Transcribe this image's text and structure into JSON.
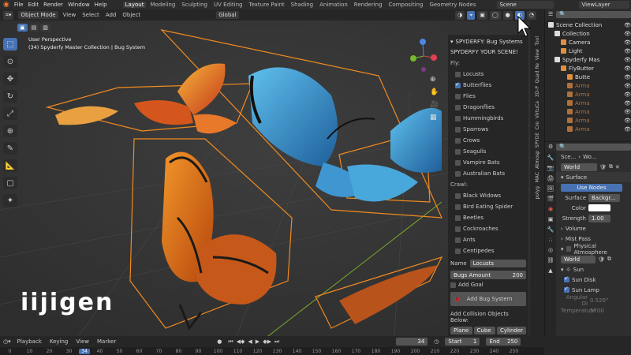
{
  "topbar": {
    "menus": [
      "File",
      "Edit",
      "Render",
      "Window",
      "Help"
    ],
    "tabs": [
      "Layout",
      "Modeling",
      "Sculpting",
      "UV Editing",
      "Texture Paint",
      "Shading",
      "Animation",
      "Rendering",
      "Compositing",
      "Geometry Nodes"
    ],
    "active_tab": "Layout",
    "scene": "Scene",
    "view_layer": "ViewLayer"
  },
  "header": {
    "mode": "Object Mode",
    "menus": [
      "View",
      "Select",
      "Add",
      "Object"
    ],
    "orientation": "Global"
  },
  "viewport": {
    "perspective": "User Perspective",
    "collection": "(34) Spyderfy Master Collection | Bug System",
    "logo": "iijigen"
  },
  "npanel": {
    "title": "SPYDERFY: Bug Systems",
    "subtitle": "SPYDERFY YOUR SCENE!",
    "fly_label": "Fly:",
    "fly": [
      {
        "label": "Locusts",
        "on": false
      },
      {
        "label": "Butterflies",
        "on": true
      },
      {
        "label": "Flies",
        "on": false
      },
      {
        "label": "Dragonflies",
        "on": false
      },
      {
        "label": "Hummingbirds",
        "on": false
      },
      {
        "label": "Sparrows",
        "on": false
      },
      {
        "label": "Crows",
        "on": false
      },
      {
        "label": "Seagulls",
        "on": false
      },
      {
        "label": "Vampire Bats",
        "on": false
      },
      {
        "label": "Australian Bats",
        "on": false
      }
    ],
    "crawl_label": "Crawl:",
    "crawl": [
      {
        "label": "Black Widows",
        "on": false
      },
      {
        "label": "Bird Eating Spider",
        "on": false
      },
      {
        "label": "Beetles",
        "on": false
      },
      {
        "label": "Cockroaches",
        "on": false
      },
      {
        "label": "Ants",
        "on": false
      },
      {
        "label": "Centipedes",
        "on": false
      }
    ],
    "name_label": "Name",
    "name_value": "Locusts",
    "amount_label": "Bugs Amount",
    "amount_value": "200",
    "add_goal": "Add Goal",
    "add_bug": "Add Bug System",
    "collision": "Add Collision Objects Below:",
    "plane": "Plane",
    "cube": "Cube",
    "cylinder": "Cylinder"
  },
  "vtabs": [
    "Tool",
    "View",
    "Quad Re",
    "3D-P",
    "VirtuCa",
    "Cre",
    "SPYDE",
    "Atmosp",
    "MAC",
    "polyg"
  ],
  "outliner": {
    "rows": [
      {
        "t": "Scene Collection",
        "d": 0
      },
      {
        "t": "Collection",
        "d": 1
      },
      {
        "t": "Camera",
        "d": 2
      },
      {
        "t": "Light",
        "d": 2
      },
      {
        "t": "Spyderfy Mas",
        "d": 1
      },
      {
        "t": "FlyButter",
        "d": 2
      },
      {
        "t": "Butte",
        "d": 3
      },
      {
        "t": "Arma",
        "d": 3
      },
      {
        "t": "Arma",
        "d": 3
      },
      {
        "t": "Arma",
        "d": 3
      },
      {
        "t": "Arma",
        "d": 3
      },
      {
        "t": "Arma",
        "d": 3
      },
      {
        "t": "Arma",
        "d": 3
      }
    ]
  },
  "props": {
    "crumb1": "Sce...",
    "crumb2": "Wo...",
    "world": "World",
    "surface": "Surface",
    "use_nodes": "Use Nodes",
    "surface_label": "Surface",
    "surface_value": "Backgr...",
    "color_label": "Color",
    "strength_label": "Strength",
    "strength_value": "1.00",
    "volume": "Volume",
    "mist": "Mist Pass",
    "phys": "Physical Atmosphere",
    "world2": "World",
    "sun": "Sun",
    "sun_disk": "Sun Disk",
    "sun_lamp": "Sun Lamp",
    "angular": "Angular Di",
    "angular_v": "0.526°",
    "temp": "Temperature",
    "temp_v": "5700"
  },
  "timeline": {
    "menus": [
      "Playback",
      "Keying",
      "View",
      "Marker"
    ],
    "frame": "34",
    "start_label": "Start",
    "start": "1",
    "end_label": "End",
    "end": "250",
    "ticks": [
      "0",
      "10",
      "20",
      "30",
      "34",
      "40",
      "50",
      "60",
      "70",
      "80",
      "90",
      "100",
      "110",
      "120",
      "130",
      "140",
      "150",
      "160",
      "170",
      "180",
      "190",
      "200",
      "210",
      "220",
      "230",
      "240",
      "250"
    ]
  },
  "colors": {
    "accent": "#4772b3",
    "selection": "#f08a20"
  }
}
